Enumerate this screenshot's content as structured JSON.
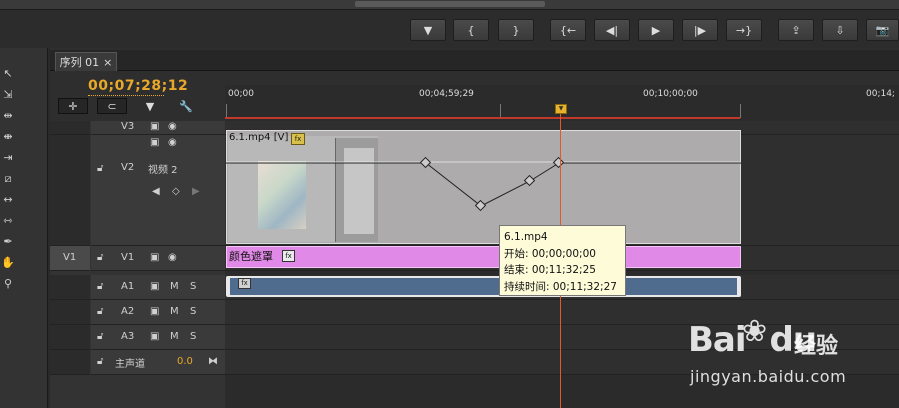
{
  "tab": {
    "title": "序列 01",
    "close": "×"
  },
  "timecode": "00;07;28;12",
  "toolbar_buttons": [
    "▼",
    "{",
    "}",
    "{←",
    "◀|",
    "▶",
    "|▶",
    "→}",
    "⇪",
    "⇩",
    "📷"
  ],
  "timeline_buttons": [
    "✛",
    "⊂",
    "▼",
    "🔧"
  ],
  "ruler": {
    "labels": [
      "00;00",
      "00;04;59;29",
      "00;10;00;00",
      "00;14;"
    ]
  },
  "tracks": {
    "v3": {
      "label": "V3"
    },
    "v2": {
      "label": "V2",
      "name": "视频 2"
    },
    "v1": {
      "source": "V1",
      "label": "V1"
    },
    "a1": {
      "label": "A1",
      "m": "M",
      "s": "S"
    },
    "a2": {
      "label": "A2",
      "m": "M",
      "s": "S"
    },
    "a3": {
      "label": "A3",
      "m": "M",
      "s": "S"
    },
    "master": {
      "label": "主声道",
      "value": "0.0"
    }
  },
  "clips": {
    "video": {
      "label": "6.1.mp4 [V]",
      "fx": "fx"
    },
    "mask": {
      "label": "颜色遮罩",
      "fx": "fx"
    },
    "audio": {
      "fx": "fx"
    }
  },
  "tooltip": {
    "title": "6.1.mp4",
    "start": "开始: 00;00;00;00",
    "end": "结束: 00;11;32;25",
    "duration": "持续时间: 00;11;32;27"
  },
  "watermark": {
    "logo": "Bai",
    "logo2": "du",
    "brand": "经验",
    "url": "jingyan.baidu.com"
  },
  "colors": {
    "timecode": "#e8a82a",
    "playhead": "#e0582c",
    "mask_clip": "#e089e6",
    "audio_clip": "#4f6c8e"
  }
}
